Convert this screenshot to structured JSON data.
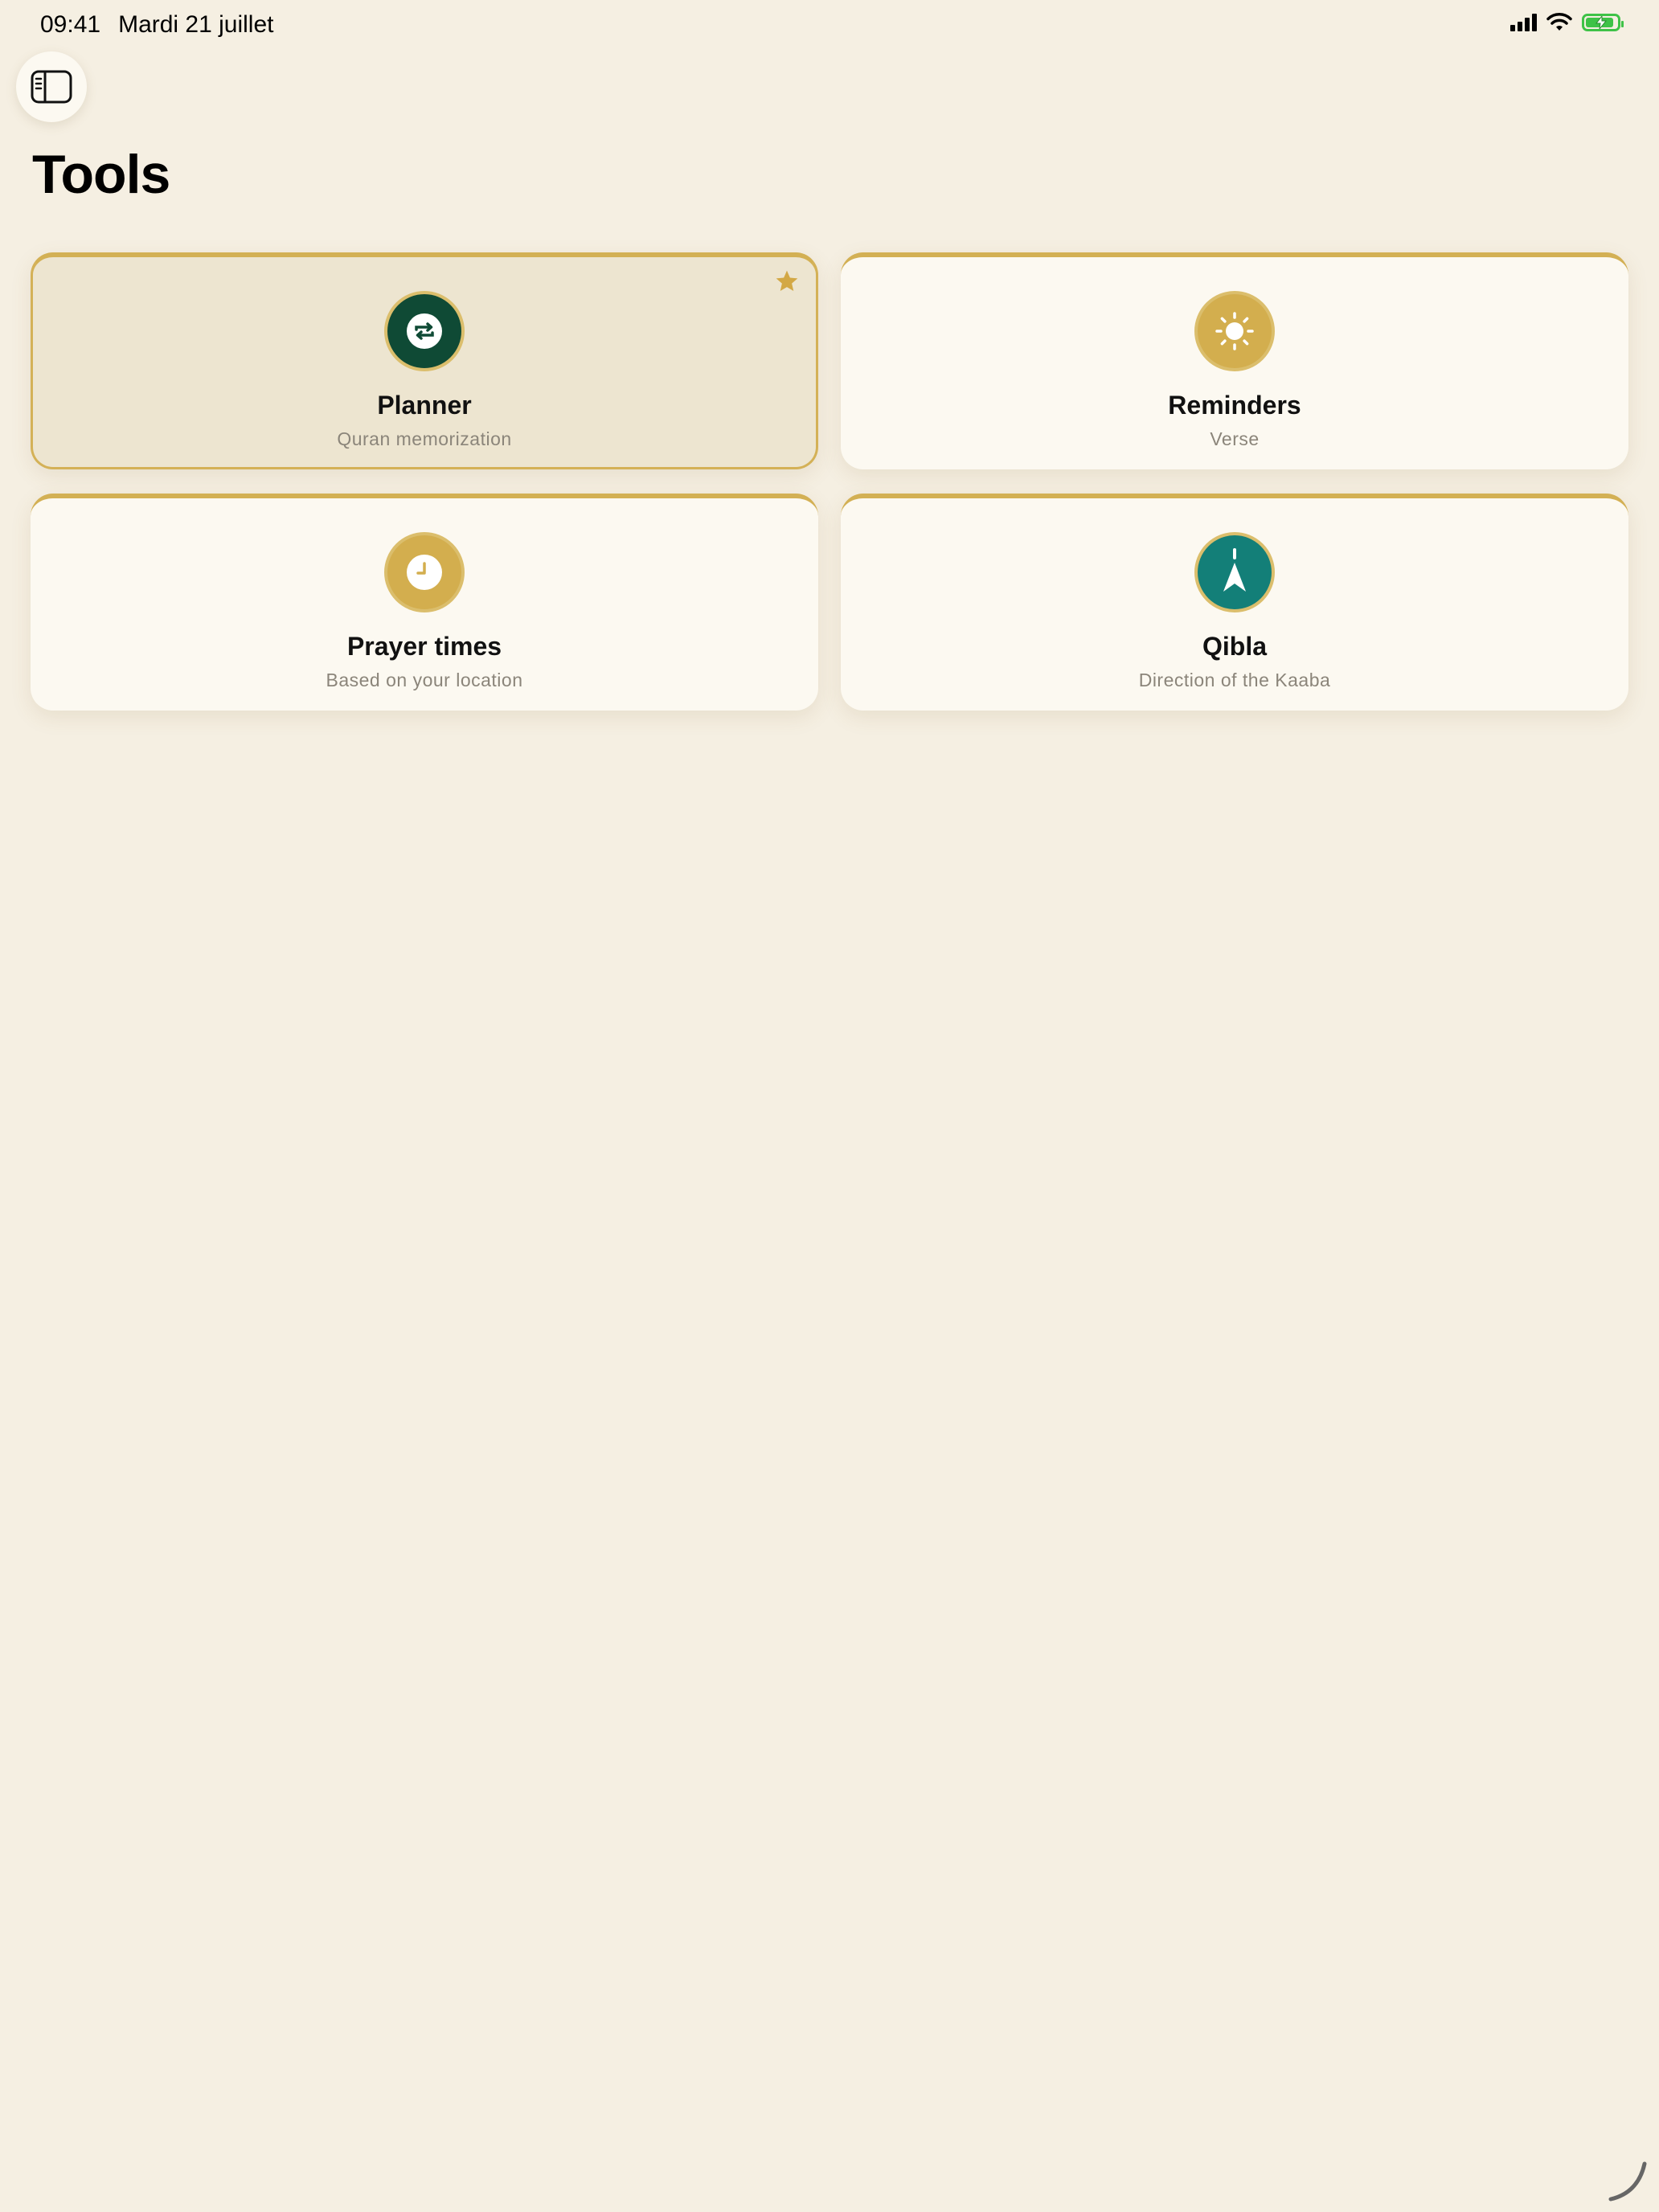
{
  "status_bar": {
    "time": "09:41",
    "date": "Mardi 21 juillet"
  },
  "page": {
    "title": "Tools"
  },
  "tools": [
    {
      "title": "Planner",
      "subtitle": "Quran memorization",
      "icon": "repeat-icon",
      "icon_color": "#0f4a35",
      "selected": true,
      "favorite": true
    },
    {
      "title": "Reminders",
      "subtitle": "Verse",
      "icon": "sun-icon",
      "icon_color": "#d3ae4e",
      "selected": false,
      "favorite": false
    },
    {
      "title": "Prayer times",
      "subtitle": "Based on your location",
      "icon": "clock-icon",
      "icon_color": "#d3ae4e",
      "selected": false,
      "favorite": false
    },
    {
      "title": "Qibla",
      "subtitle": "Direction of the Kaaba",
      "icon": "compass-arrow-icon",
      "icon_color": "#137f78",
      "selected": false,
      "favorite": false
    }
  ],
  "colors": {
    "background": "#f5efe2",
    "accent_gold": "#d3b054",
    "card_bg": "#fcf9f1",
    "selected_card_bg": "#ede5d0"
  }
}
